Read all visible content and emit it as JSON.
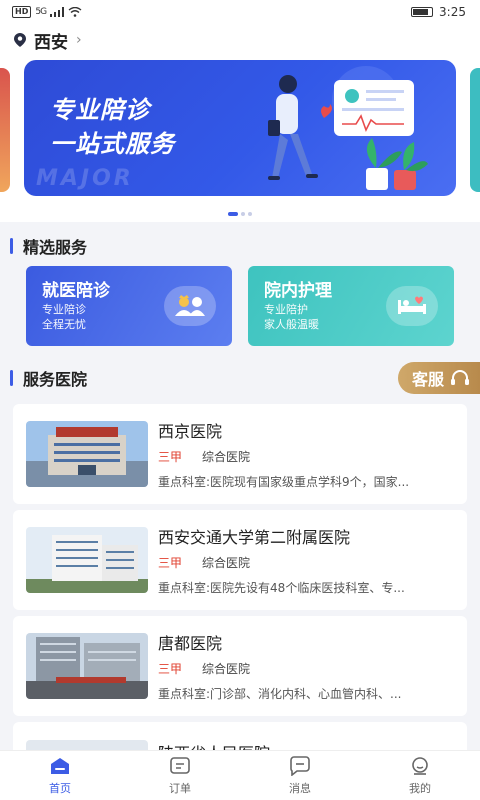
{
  "status": {
    "hd": "HD",
    "network": "5G",
    "time": "3:25"
  },
  "location": {
    "city": "西安"
  },
  "banner": {
    "line1": "专业陪诊",
    "line2": "一站式服务",
    "watermark": "MAJOR",
    "slide_count": 3,
    "active_slide": 1
  },
  "featured": {
    "title": "精选服务",
    "cards": [
      {
        "title": "就医陪诊",
        "sub1": "专业陪诊",
        "sub2": "全程无忧",
        "icon": "people-icon"
      },
      {
        "title": "院内护理",
        "sub1": "专业陪护",
        "sub2": "家人般温暖",
        "icon": "nursing-bed-icon"
      }
    ]
  },
  "hospitals": {
    "title": "服务医院",
    "customer_service": "客服",
    "items": [
      {
        "name": "西京医院",
        "level": "三甲",
        "type": "综合医院",
        "desc": "重点科室:医院现有国家级重点学科9个，国家..."
      },
      {
        "name": "西安交通大学第二附属医院",
        "level": "三甲",
        "type": "综合医院",
        "desc": "重点科室:医院先设有48个临床医技科室、专..."
      },
      {
        "name": "唐都医院",
        "level": "三甲",
        "type": "综合医院",
        "desc": "重点科室:门诊部、消化内科、心血管内科、..."
      },
      {
        "name": "陕西省人民医院",
        "level": "",
        "type": "",
        "desc": ""
      }
    ]
  },
  "tabbar": {
    "items": [
      {
        "label": "首页",
        "active": true
      },
      {
        "label": "订单",
        "active": false
      },
      {
        "label": "消息",
        "active": false
      },
      {
        "label": "我的",
        "active": false
      }
    ]
  },
  "colors": {
    "accent": "#3c5ce5",
    "level_red": "#e0402f",
    "gold": "#c49a5c",
    "teal": "#3ec3bf"
  }
}
